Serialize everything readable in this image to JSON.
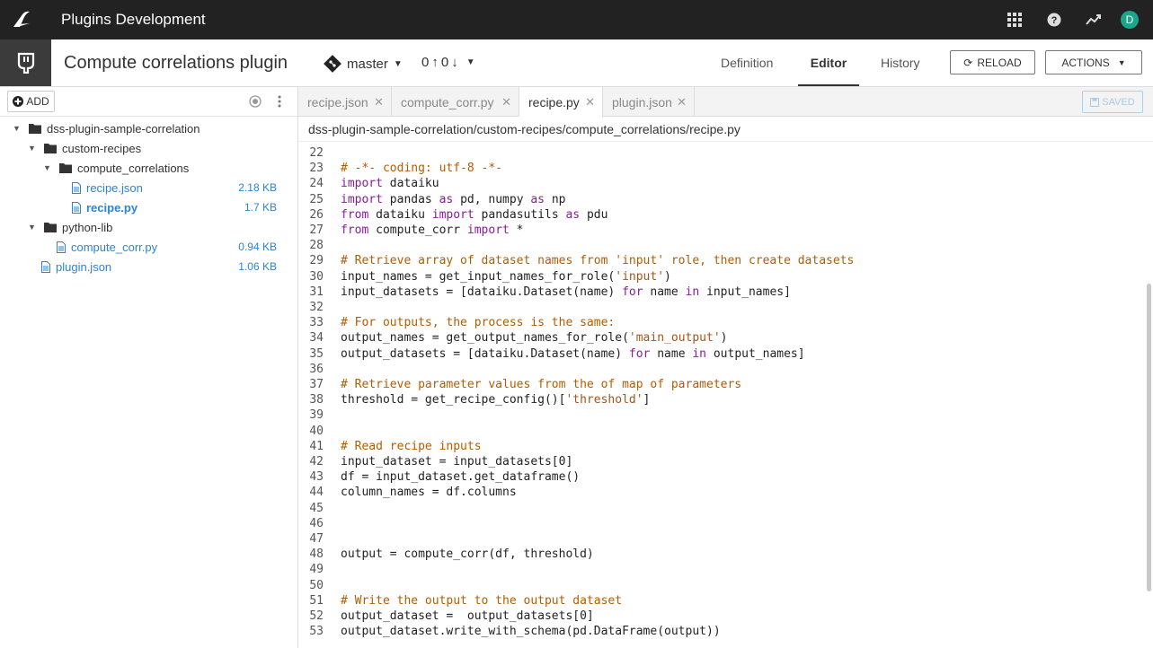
{
  "topbar": {
    "app_title": "Plugins Development",
    "avatar_initial": "D"
  },
  "header": {
    "plugin_name": "Compute correlations plugin",
    "branch": "master",
    "ahead": "0",
    "behind": "0",
    "nav_tabs": [
      "Definition",
      "Editor",
      "History"
    ],
    "active_tab": "Editor",
    "reload_label": "RELOAD",
    "actions_label": "ACTIONS"
  },
  "sidebar": {
    "add_label": "ADD",
    "tree": [
      {
        "label": "dss-plugin-sample-correlation",
        "type": "folder",
        "depth": 0,
        "size": ""
      },
      {
        "label": "custom-recipes",
        "type": "folder",
        "depth": 1,
        "size": ""
      },
      {
        "label": "compute_correlations",
        "type": "folder",
        "depth": 2,
        "size": ""
      },
      {
        "label": "recipe.json",
        "type": "file",
        "depth": 3,
        "size": "2.18 KB"
      },
      {
        "label": "recipe.py",
        "type": "file",
        "depth": 3,
        "size": "1.7 KB",
        "active": true
      },
      {
        "label": "python-lib",
        "type": "folder",
        "depth": 1,
        "size": ""
      },
      {
        "label": "compute_corr.py",
        "type": "file",
        "depth": 2,
        "size": "0.94 KB"
      },
      {
        "label": "plugin.json",
        "type": "file",
        "depth": 1,
        "size": "1.06 KB"
      }
    ]
  },
  "editor": {
    "tabs": [
      "recipe.json",
      "compute_corr.py",
      "recipe.py",
      "plugin.json"
    ],
    "active_tab": "recipe.py",
    "saved_label": "SAVED",
    "path": "dss-plugin-sample-correlation/custom-recipes/compute_correlations/recipe.py",
    "lines": [
      {
        "n": "22",
        "t": ""
      },
      {
        "n": "23",
        "t": "# -*- coding: utf-8 -*-"
      },
      {
        "n": "24",
        "t": "import dataiku"
      },
      {
        "n": "25",
        "t": "import pandas as pd, numpy as np"
      },
      {
        "n": "26",
        "t": "from dataiku import pandasutils as pdu"
      },
      {
        "n": "27",
        "t": "from compute_corr import *"
      },
      {
        "n": "28",
        "t": ""
      },
      {
        "n": "29",
        "t": "# Retrieve array of dataset names from 'input' role, then create datasets"
      },
      {
        "n": "30",
        "t": "input_names = get_input_names_for_role('input')"
      },
      {
        "n": "31",
        "t": "input_datasets = [dataiku.Dataset(name) for name in input_names]"
      },
      {
        "n": "32",
        "t": ""
      },
      {
        "n": "33",
        "t": "# For outputs, the process is the same:"
      },
      {
        "n": "34",
        "t": "output_names = get_output_names_for_role('main_output')"
      },
      {
        "n": "35",
        "t": "output_datasets = [dataiku.Dataset(name) for name in output_names]"
      },
      {
        "n": "36",
        "t": ""
      },
      {
        "n": "37",
        "t": "# Retrieve parameter values from the of map of parameters"
      },
      {
        "n": "38",
        "t": "threshold = get_recipe_config()['threshold']"
      },
      {
        "n": "39",
        "t": ""
      },
      {
        "n": "40",
        "t": ""
      },
      {
        "n": "41",
        "t": "# Read recipe inputs"
      },
      {
        "n": "42",
        "t": "input_dataset = input_datasets[0]"
      },
      {
        "n": "43",
        "t": "df = input_dataset.get_dataframe()"
      },
      {
        "n": "44",
        "t": "column_names = df.columns"
      },
      {
        "n": "45",
        "t": ""
      },
      {
        "n": "46",
        "t": ""
      },
      {
        "n": "47",
        "t": ""
      },
      {
        "n": "48",
        "t": "output = compute_corr(df, threshold)"
      },
      {
        "n": "49",
        "t": ""
      },
      {
        "n": "50",
        "t": ""
      },
      {
        "n": "51",
        "t": "# Write the output to the output dataset"
      },
      {
        "n": "52",
        "t": "output_dataset =  output_datasets[0]"
      },
      {
        "n": "53",
        "t": "output_dataset.write_with_schema(pd.DataFrame(output))"
      }
    ]
  },
  "colors": {
    "topbar_bg": "#222222",
    "link_blue": "#2d83d6",
    "keyword": "#8a1b9a",
    "string": "#a5541a",
    "comment": "#b35c00"
  }
}
